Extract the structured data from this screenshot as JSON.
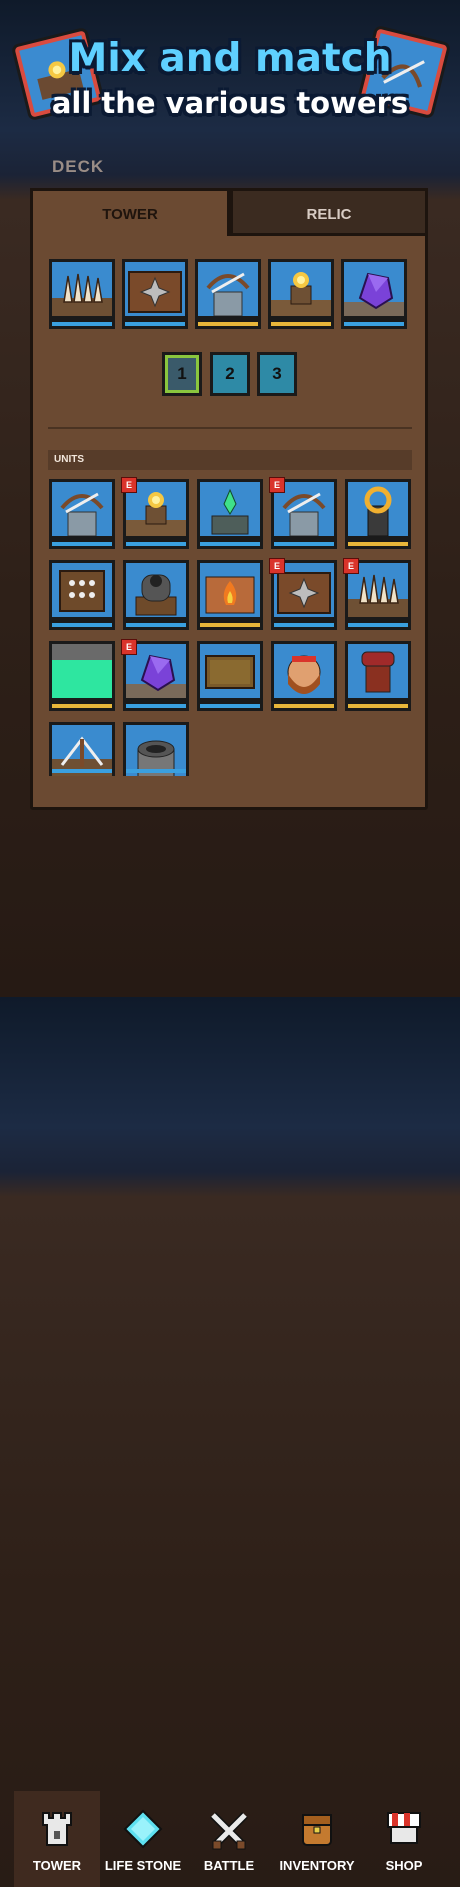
{
  "hero": {
    "line1": "Mix and match",
    "line2": "all the various towers"
  },
  "deck": {
    "label": "DECK"
  },
  "tabs": [
    {
      "label": "TOWER",
      "active": true
    },
    {
      "label": "RELIC",
      "active": false
    }
  ],
  "deck_towers": [
    {
      "icon": "spike-trap-icon",
      "bar": "blue"
    },
    {
      "icon": "shuriken-crate-icon",
      "bar": "blue"
    },
    {
      "icon": "crossbow-tower-icon",
      "bar": "gold"
    },
    {
      "icon": "fire-orb-tower-icon",
      "bar": "gold"
    },
    {
      "icon": "purple-crystal-icon",
      "bar": "blue"
    }
  ],
  "deck_slots": [
    "1",
    "2",
    "3"
  ],
  "units_label": "UNITS",
  "units": [
    {
      "icon": "crossbow-tower-icon",
      "badge": "",
      "bar": "blue"
    },
    {
      "icon": "fire-orb-tower-icon",
      "badge": "E",
      "bar": "blue"
    },
    {
      "icon": "green-crystal-altar-icon",
      "badge": "",
      "bar": "blue"
    },
    {
      "icon": "crossbow-tower-icon",
      "badge": "E",
      "bar": "blue"
    },
    {
      "icon": "gold-ring-pillar-icon",
      "badge": "",
      "bar": "gold"
    },
    {
      "icon": "spike-board-icon",
      "badge": "",
      "bar": "blue"
    },
    {
      "icon": "cannon-icon",
      "badge": "",
      "bar": "blue"
    },
    {
      "icon": "brazier-icon",
      "badge": "",
      "bar": "gold"
    },
    {
      "icon": "shuriken-crate-icon",
      "badge": "E",
      "bar": "blue"
    },
    {
      "icon": "spike-trap-icon",
      "badge": "E",
      "bar": "blue"
    },
    {
      "icon": "acid-pool-icon",
      "badge": "",
      "bar": "gold"
    },
    {
      "icon": "purple-crystal-icon",
      "badge": "E",
      "bar": "blue"
    },
    {
      "icon": "wooden-plank-icon",
      "badge": "",
      "bar": "blue"
    },
    {
      "icon": "barbarian-hero-icon",
      "badge": "",
      "bar": "gold"
    },
    {
      "icon": "red-banner-icon",
      "badge": "",
      "bar": "gold"
    },
    {
      "icon": "ballista-icon",
      "badge": "",
      "bar": "blue"
    },
    {
      "icon": "well-icon",
      "badge": "",
      "bar": "blue"
    }
  ],
  "nav": [
    {
      "label": "TOWER",
      "icon": "tower-icon",
      "active": true
    },
    {
      "label": "LIFE STONE",
      "icon": "diamond-gem-icon",
      "active": false
    },
    {
      "label": "BATTLE",
      "icon": "crossed-swords-icon",
      "active": false
    },
    {
      "label": "INVENTORY",
      "icon": "backpack-icon",
      "active": false
    },
    {
      "label": "SHOP",
      "icon": "shop-awning-icon",
      "active": false
    }
  ],
  "colors": {
    "accent_blue": "#3a8bcf",
    "bar_blue": "#3aa0e0",
    "bar_gold": "#e8b63a",
    "panel_brown": "#6b4a32",
    "badge_red": "#d9342b"
  }
}
